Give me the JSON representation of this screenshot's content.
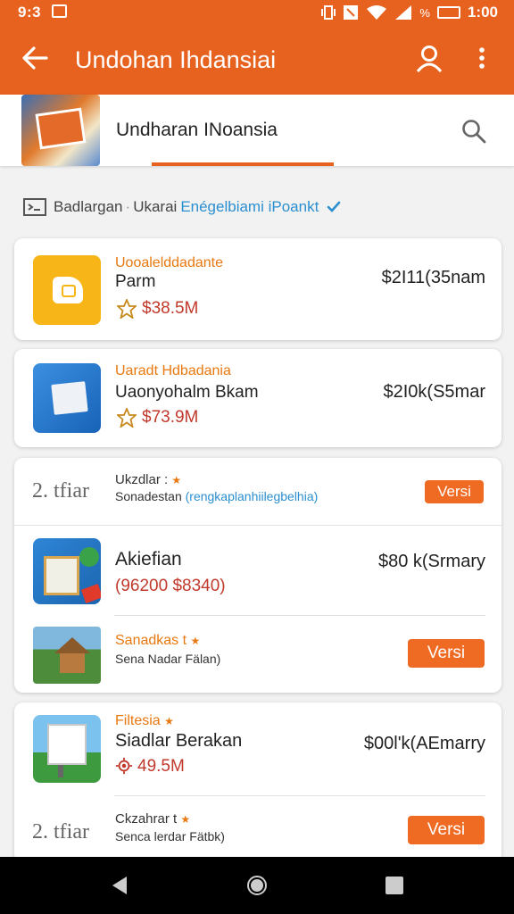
{
  "status_bar": {
    "time": "9:3",
    "clock": "1:00",
    "signal_pct": "%"
  },
  "app_bar": {
    "title": "Undohan Ihdansiai"
  },
  "header": {
    "name": "Undharan INoansia"
  },
  "filter": {
    "label": "Badlargan",
    "sep": "Ukarai",
    "link": "Enégelbiami iPoankt"
  },
  "cards": [
    {
      "category": "Uooalelddadante",
      "name": "Parm",
      "amount": "$38.5M",
      "price": "$2I11(35nam"
    },
    {
      "category": "Uaradt Hdbadania",
      "name": "Uaonyohalm Bkam",
      "amount": "$73.9M",
      "price": "$2I0k(S5mar"
    }
  ],
  "section1": {
    "rank": "2. tfiar",
    "title": "Ukzdlar :",
    "subtitle": "Sonadestan",
    "subtitle_link": "(rengkaplanhiilegbelhia)",
    "button": "Versi",
    "item": {
      "name": "Akiefian",
      "amount": "(96200 $8340)",
      "price": "$80 k(Srmary"
    },
    "sub_item": {
      "category": "Sanadkas t",
      "desc": "Sena Nadar Fälan)",
      "button": "Versi"
    }
  },
  "section2": {
    "category": "Filtesia",
    "name": "Siadlar Berakan",
    "amount": "49.5M",
    "price": "$00l'k(AEmarry",
    "rank": "2. tfiar",
    "sub_title": "Ckzahrar t",
    "sub_desc": "Senca lerdar Fätbk)",
    "button": "Versi"
  },
  "colors": {
    "accent": "#e8621f",
    "button": "#ef6a22",
    "link": "#2b8fd0",
    "red_value": "#c0392b"
  }
}
